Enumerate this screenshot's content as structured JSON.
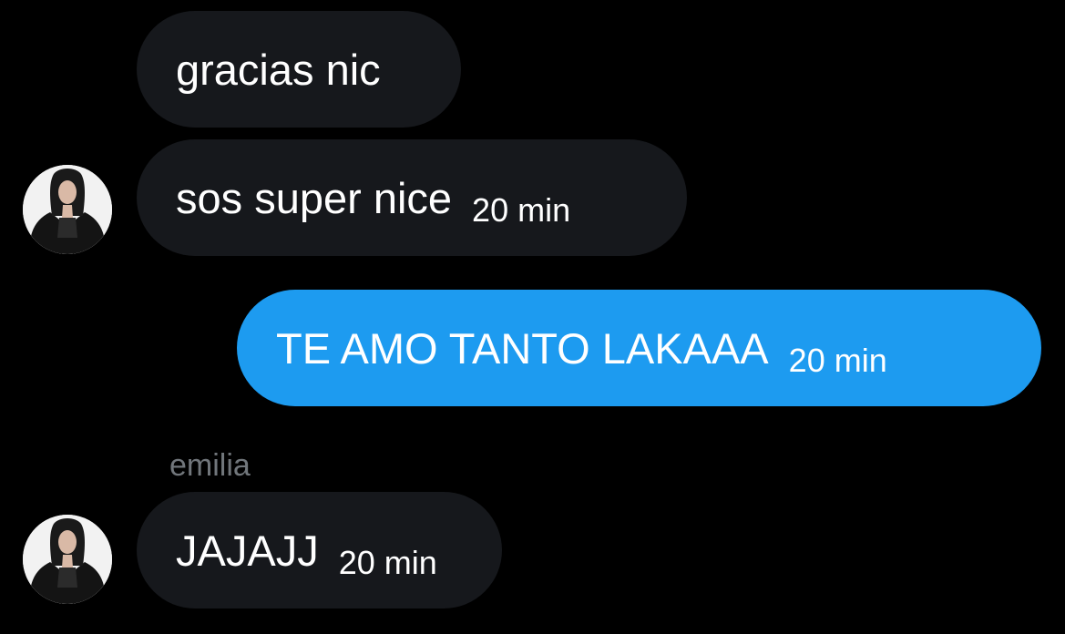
{
  "conversation": {
    "messages": [
      {
        "text": "gracias nic",
        "time": ""
      },
      {
        "text": "sos super nice",
        "time": "20 min"
      },
      {
        "text": "TE AMO TANTO LAKAAA",
        "time": "20 min"
      },
      {
        "sender": "emilia",
        "text": "JAJAJJ",
        "time": "20 min"
      }
    ]
  },
  "colors": {
    "background": "#000000",
    "received_bubble": "#16181c",
    "sent_bubble": "#1d9bf0",
    "sender_name": "#71767b"
  },
  "icons": {
    "avatar": "profile-photo-avatar"
  }
}
